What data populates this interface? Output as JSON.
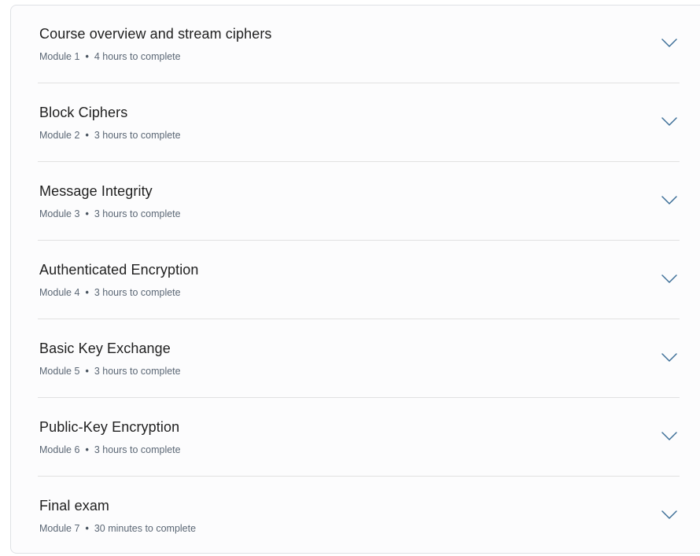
{
  "modules": [
    {
      "title": "Course overview and stream ciphers",
      "module": "Module 1",
      "separator": "•",
      "duration": "4 hours to complete",
      "icon": "chevron-down-icon"
    },
    {
      "title": "Block Ciphers",
      "module": "Module 2",
      "separator": "•",
      "duration": "3 hours to complete",
      "icon": "chevron-down-icon"
    },
    {
      "title": "Message Integrity",
      "module": "Module 3",
      "separator": "•",
      "duration": "3 hours to complete",
      "icon": "chevron-down-icon"
    },
    {
      "title": "Authenticated Encryption",
      "module": "Module 4",
      "separator": "•",
      "duration": "3 hours to complete",
      "icon": "chevron-down-icon"
    },
    {
      "title": "Basic Key Exchange",
      "module": "Module 5",
      "separator": "•",
      "duration": "3 hours to complete",
      "icon": "chevron-down-icon"
    },
    {
      "title": "Public-Key Encryption",
      "module": "Module 6",
      "separator": "•",
      "duration": "3 hours to complete",
      "icon": "chevron-down-icon"
    },
    {
      "title": "Final exam",
      "module": "Module 7",
      "separator": "•",
      "duration": "30 minutes to complete",
      "icon": "chevron-down-icon"
    }
  ],
  "colors": {
    "title": "#1f1f1f",
    "meta": "#5b6775",
    "chevron": "#3d6f98",
    "divider": "#e1e1e1",
    "card_border": "#dfe1e5"
  }
}
